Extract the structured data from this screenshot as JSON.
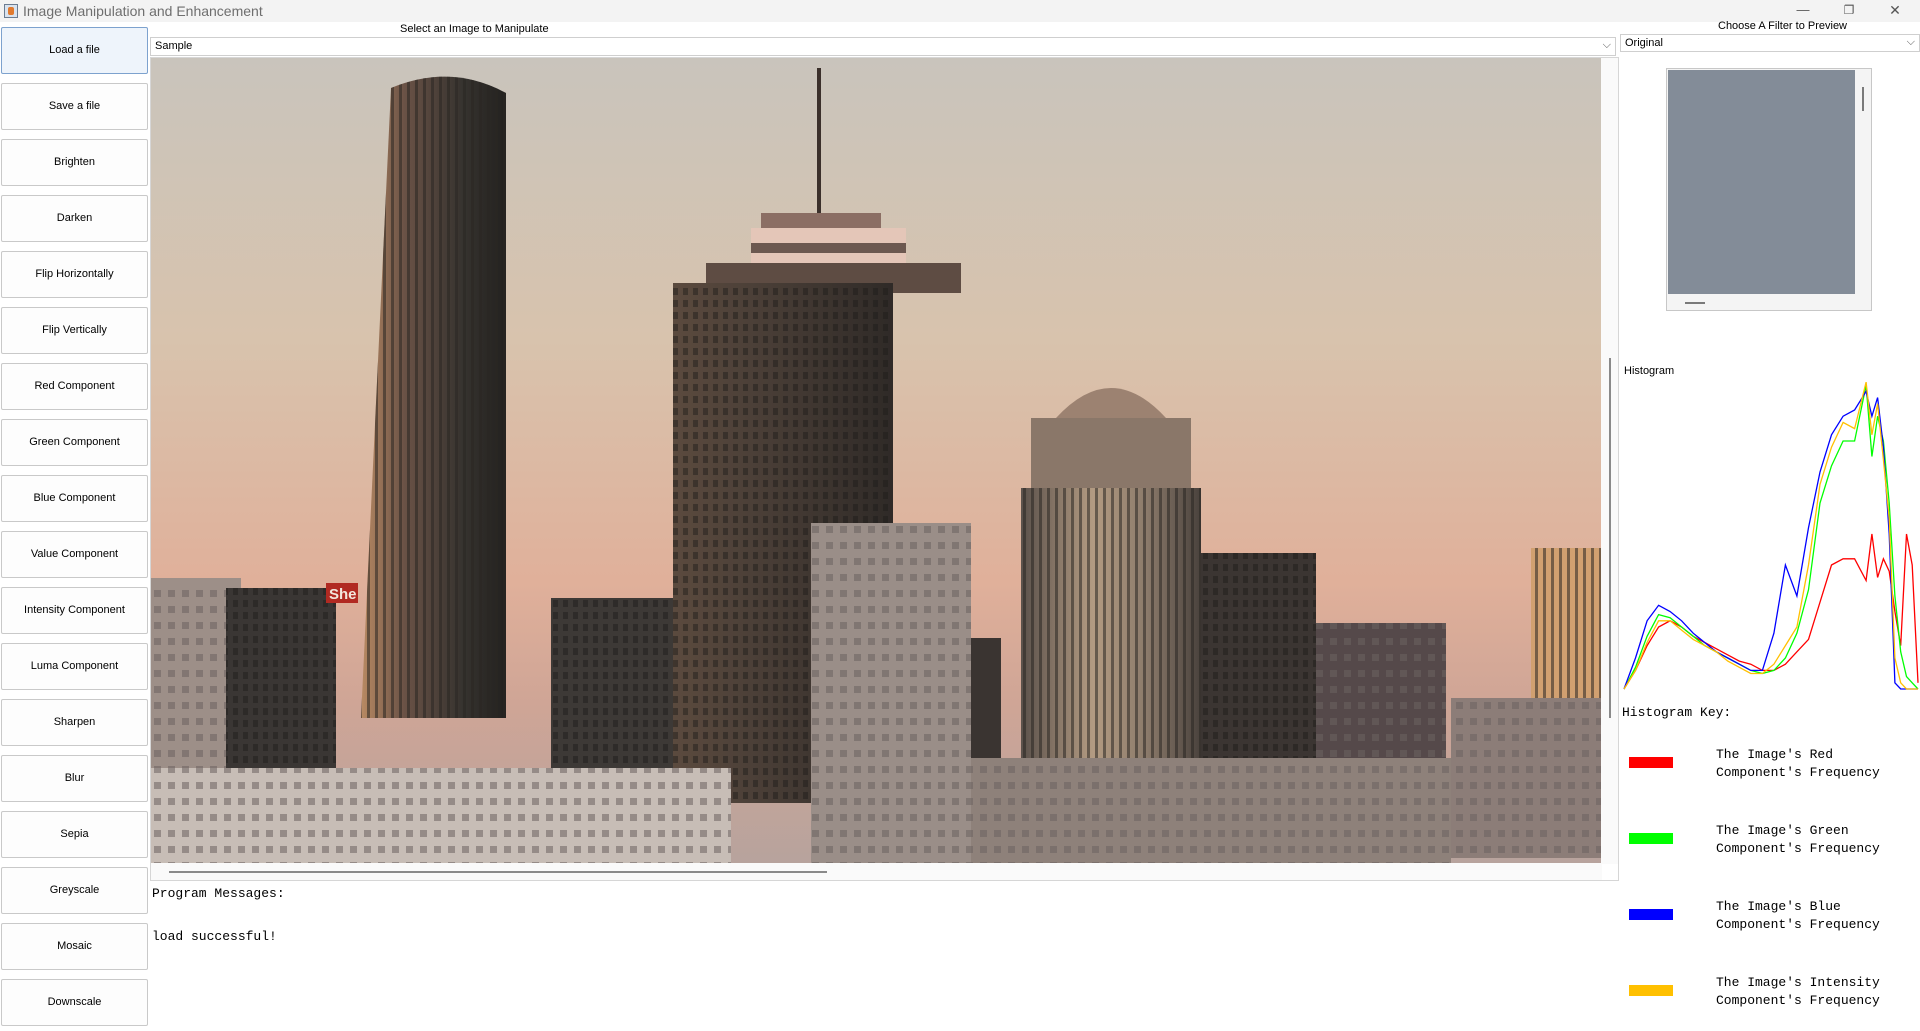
{
  "window": {
    "title": "Image Manipulation and Enhancement",
    "controls": {
      "minimize": "—",
      "restore": "❐",
      "close": "✕"
    }
  },
  "sidebar": {
    "buttons": [
      {
        "label": "Load a file",
        "active": true
      },
      {
        "label": "Save a file"
      },
      {
        "label": "Brighten"
      },
      {
        "label": "Darken"
      },
      {
        "label": "Flip Horizontally"
      },
      {
        "label": "Flip Vertically"
      },
      {
        "label": "Red Component"
      },
      {
        "label": "Green Component"
      },
      {
        "label": "Blue Component"
      },
      {
        "label": "Value Component"
      },
      {
        "label": "Intensity Component"
      },
      {
        "label": "Luma Component"
      },
      {
        "label": "Sharpen"
      },
      {
        "label": "Blur"
      },
      {
        "label": "Sepia"
      },
      {
        "label": "Greyscale"
      },
      {
        "label": "Mosaic"
      },
      {
        "label": "Downscale"
      }
    ]
  },
  "image_select": {
    "label": "Select an Image to Manipulate",
    "value": "Sample"
  },
  "image_view": {
    "description_icon": "city-skyline-photo",
    "storefront_sign": "She"
  },
  "messages": {
    "label": "Program Messages:",
    "text": "load successful!"
  },
  "filter_preview": {
    "label": "Choose A Filter to Preview",
    "value": "Original"
  },
  "histogram": {
    "label": "Histogram",
    "key_title": "Histogram Key:",
    "key": [
      {
        "line1": "The Image's Red",
        "line2": "Component's Frequency",
        "color": "#ff0000"
      },
      {
        "line1": "The Image's Green",
        "line2": "Component's Frequency",
        "color": "#00ff00"
      },
      {
        "line1": "The Image's Blue",
        "line2": "Component's Frequency",
        "color": "#0000ff"
      },
      {
        "line1": "The Image's Intensity",
        "line2": "Component's Frequency",
        "color": "#ffc000"
      }
    ]
  },
  "chart_data": {
    "type": "line",
    "title": "",
    "xlabel": "",
    "ylabel": "",
    "xlim": [
      0,
      255
    ],
    "ylim": [
      0,
      100
    ],
    "series": [
      {
        "color": "#ff0000",
        "x": [
          0,
          10,
          20,
          30,
          40,
          50,
          60,
          70,
          80,
          90,
          100,
          110,
          120,
          130,
          140,
          150,
          160,
          170,
          180,
          190,
          200,
          210,
          215,
          220,
          225,
          230,
          235,
          240,
          245,
          250,
          255
        ],
        "values": [
          0,
          6,
          14,
          20,
          22,
          20,
          17,
          15,
          13,
          11,
          9,
          8,
          6,
          6,
          8,
          12,
          16,
          28,
          40,
          42,
          42,
          35,
          50,
          36,
          42,
          38,
          25,
          14,
          50,
          40,
          2
        ]
      },
      {
        "color": "#00ff00",
        "x": [
          0,
          10,
          20,
          30,
          40,
          50,
          60,
          70,
          80,
          90,
          100,
          110,
          120,
          130,
          140,
          150,
          160,
          170,
          180,
          190,
          200,
          210,
          215,
          220,
          225,
          230,
          235,
          240,
          245,
          250,
          255
        ],
        "values": [
          0,
          7,
          17,
          24,
          23,
          20,
          17,
          14,
          12,
          10,
          8,
          6,
          5,
          6,
          10,
          18,
          32,
          60,
          72,
          80,
          80,
          98,
          75,
          88,
          80,
          60,
          30,
          12,
          4,
          2,
          0
        ]
      },
      {
        "color": "#0000ff",
        "x": [
          0,
          10,
          20,
          30,
          40,
          50,
          60,
          70,
          80,
          90,
          100,
          110,
          120,
          130,
          140,
          150,
          160,
          170,
          180,
          190,
          200,
          210,
          215,
          220,
          225,
          230,
          235,
          240,
          245,
          250,
          255
        ],
        "values": [
          0,
          10,
          22,
          27,
          25,
          22,
          18,
          15,
          12,
          10,
          8,
          6,
          6,
          18,
          40,
          30,
          52,
          70,
          82,
          88,
          90,
          96,
          88,
          94,
          78,
          50,
          2,
          0,
          0,
          0,
          0
        ]
      },
      {
        "color": "#ffc000",
        "x": [
          0,
          10,
          20,
          30,
          40,
          50,
          60,
          70,
          80,
          90,
          100,
          110,
          120,
          130,
          140,
          150,
          160,
          170,
          180,
          190,
          200,
          210,
          215,
          220,
          225,
          230,
          235,
          240,
          245,
          250,
          255
        ],
        "values": [
          0,
          6,
          15,
          22,
          22,
          19,
          16,
          14,
          12,
          9,
          7,
          5,
          5,
          8,
          14,
          20,
          40,
          66,
          78,
          86,
          84,
          99,
          82,
          92,
          74,
          55,
          10,
          2,
          0,
          0,
          0
        ]
      }
    ]
  }
}
